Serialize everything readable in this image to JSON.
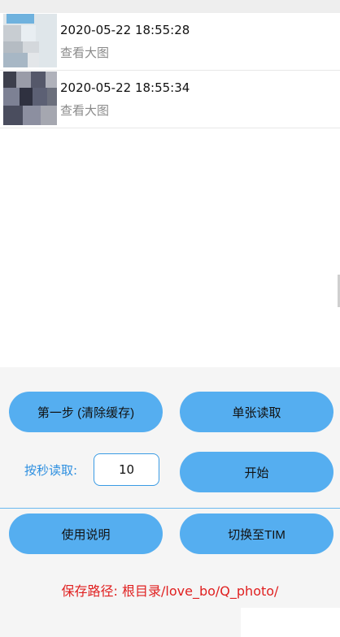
{
  "records": [
    {
      "timestamp": "2020-05-22 18:55:28",
      "link": "查看大图"
    },
    {
      "timestamp": "2020-05-22 18:55:34",
      "link": "查看大图"
    }
  ],
  "controls": {
    "step1": "第一步 (清除缓存)",
    "single_read": "单张读取",
    "seconds_label": "按秒读取:",
    "seconds_value": "10",
    "start": "开始",
    "help": "使用说明",
    "switch_tim": "切换至TIM"
  },
  "save_path": "保存路径: 根目录/love_bo/Q_photo/",
  "colors": {
    "button": "#55aef0",
    "accent": "#2d8fe0",
    "path": "#e02020"
  }
}
